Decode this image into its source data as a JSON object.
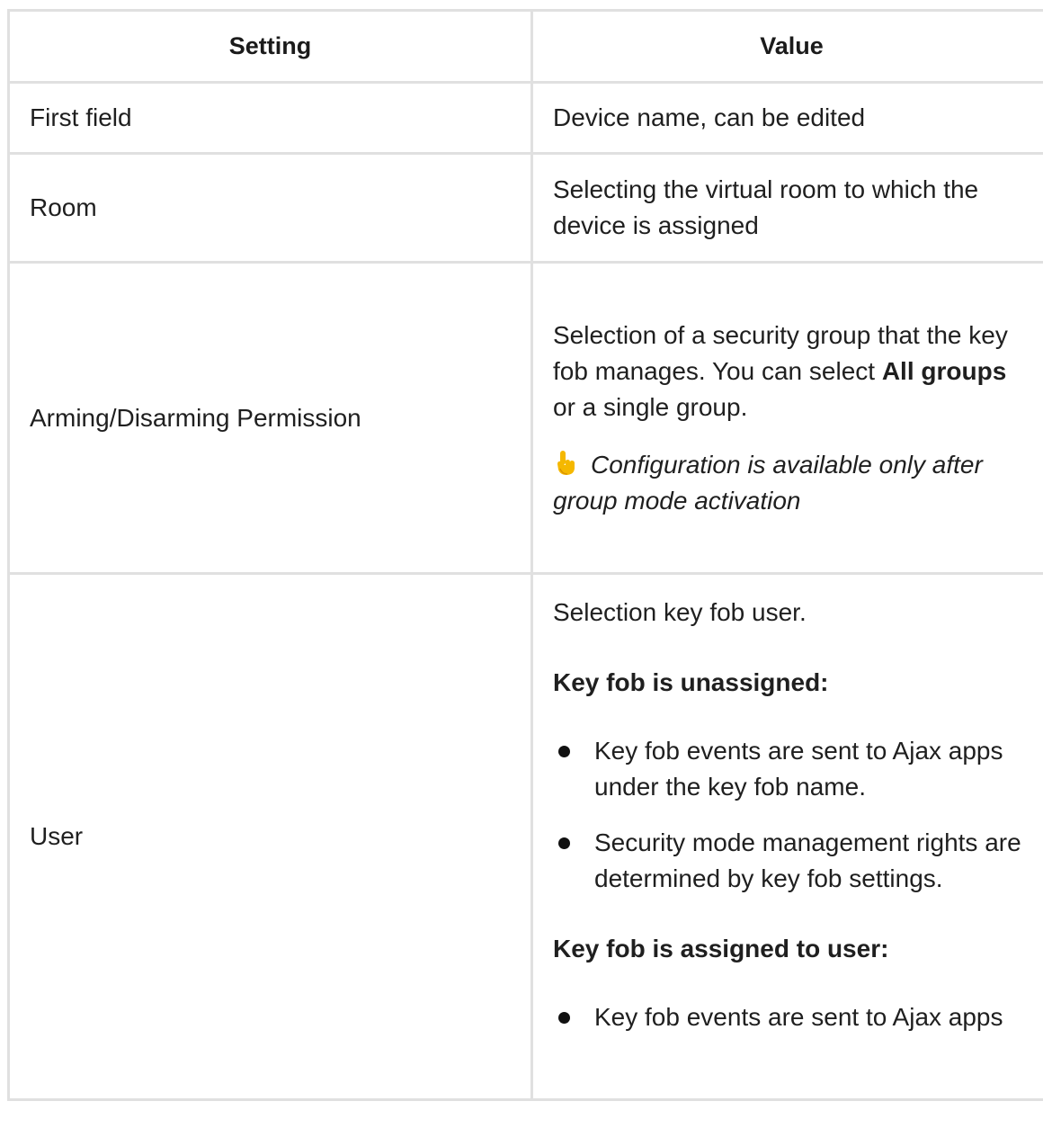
{
  "table": {
    "headers": {
      "setting": "Setting",
      "value": "Value"
    },
    "rows": [
      {
        "setting": "First field",
        "value": "Device name, can be edited"
      },
      {
        "setting": "Room",
        "value": "Selecting the virtual room to which the device is assigned"
      },
      {
        "setting": "Arming/Disarming Permission",
        "value_part1": "Selection of a security group that the key fob manages. You can select ",
        "value_bold": "All groups",
        "value_part2": " or a single group.",
        "note": "Configuration is available only after group mode activation",
        "note_icon": "pointing-hand-icon"
      },
      {
        "setting": "User",
        "intro": "Selection key fob user.",
        "unassigned_heading": "Key fob is unassigned:",
        "unassigned_items": [
          "Key fob events are sent to Ajax apps under the key fob name.",
          "Security mode management rights are determined by key fob settings."
        ],
        "assigned_heading": "Key fob is assigned to user:",
        "assigned_items": [
          "Key fob events are sent to Ajax apps"
        ]
      }
    ]
  },
  "colors": {
    "border": "#e0e0e0",
    "text": "#1f1f1f",
    "note_icon": "#f5b800"
  }
}
